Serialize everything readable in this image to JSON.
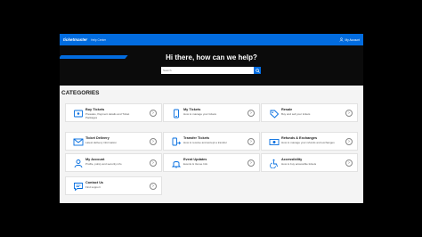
{
  "header": {
    "brand": "ticketmaster",
    "help": "Help Center",
    "signin": "My Account"
  },
  "hero": {
    "title": "Hi there, how can we help?",
    "search_placeholder": "Search"
  },
  "categories": {
    "title": "CATEGORIES",
    "items": [
      {
        "title": "Buy Tickets",
        "desc": "Presales, Payment details and Ticket Packages",
        "icon": "ticket-icon"
      },
      {
        "title": "My Tickets",
        "desc": "How to manage your tickets",
        "icon": "phone-icon"
      },
      {
        "title": "Resale",
        "desc": "Buy and sell your tickets",
        "icon": "tag-icon"
      },
      {
        "title": "Ticket Delivery",
        "desc": "Latest delivery information",
        "icon": "envelope-icon"
      },
      {
        "title": "Transfer Tickets",
        "desc": "How to receive and accept a transfer",
        "icon": "transfer-icon"
      },
      {
        "title": "Refunds & Exchanges",
        "desc": "How to manage your refunds and exchanges",
        "icon": "refund-icon"
      },
      {
        "title": "My Account",
        "desc": "Profile, policy and security info",
        "icon": "user-icon"
      },
      {
        "title": "Event Updates",
        "desc": "Events & Venue Info",
        "icon": "bell-icon"
      },
      {
        "title": "Accessibility",
        "desc": "How to buy accessible tickets",
        "icon": "accessibility-icon"
      },
      {
        "title": "Contact Us",
        "desc": "Find support",
        "icon": "chat-icon"
      }
    ]
  }
}
